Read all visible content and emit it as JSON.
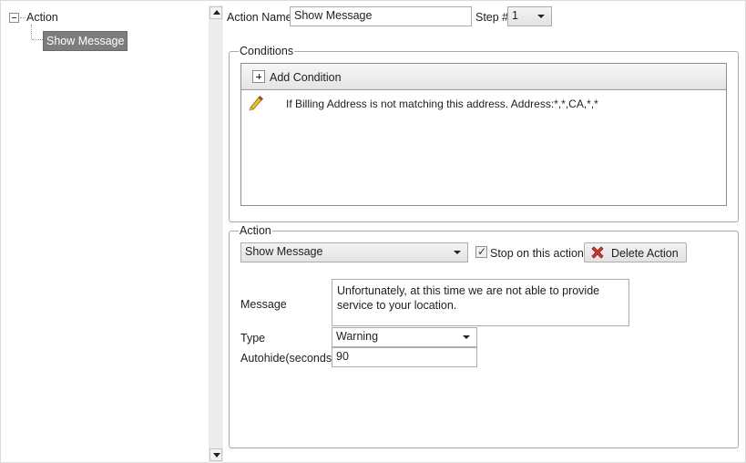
{
  "tree": {
    "root_label": "Action",
    "child_label": "Show Message"
  },
  "form": {
    "action_name_label": "Action Name",
    "action_name_value": "Show Message",
    "step_label": "Step #",
    "step_value": "1"
  },
  "conditions": {
    "group_title": "Conditions",
    "add_label": "Add Condition",
    "items": [
      {
        "text": "If Billing Address is not matching this address. Address:*,*,CA,*,*"
      }
    ]
  },
  "action": {
    "group_title": "Action",
    "type_select_value": "Show Message",
    "stop_checkbox_label": "Stop on this action",
    "stop_checked": true,
    "delete_label": "Delete Action",
    "message_label": "Message",
    "message_value": "Unfortunately, at this time we are not able to provide service to your location.",
    "type_label": "Type",
    "type_value": "Warning",
    "autohide_label": "Autohide(seconds)",
    "autohide_value": "90"
  },
  "icons": {
    "tree_expander": "collapse-icon",
    "add": "plus-icon",
    "edit": "pencil-icon",
    "delete": "red-x-icon"
  },
  "colors": {
    "selection": "#7d7d7d",
    "delete_icon": "#d9342b",
    "pencil": "#e8c02a"
  }
}
